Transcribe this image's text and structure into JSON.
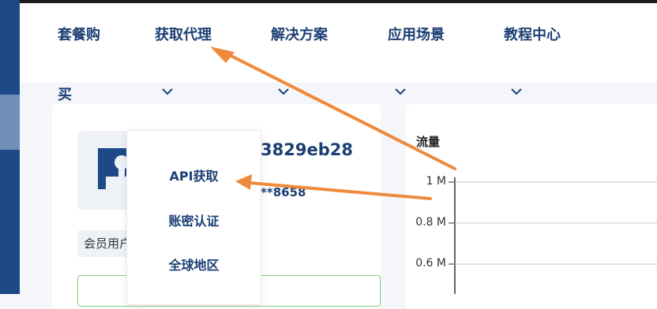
{
  "nav": {
    "items": [
      {
        "label_line1": "套餐购",
        "label_line2": "买"
      },
      {
        "label_line1": "获取代理",
        "label_line2": ""
      },
      {
        "label_line1": "解决方案",
        "label_line2": ""
      },
      {
        "label_line1": "应用场景",
        "label_line2": ""
      },
      {
        "label_line1": "教程中心",
        "label_line2": ""
      }
    ]
  },
  "account": {
    "id_partial": "3829eb28",
    "phone_partial": "**8658",
    "member_label": "会员用户"
  },
  "dropdown": {
    "items": [
      "API获取",
      "账密认证",
      "全球地区"
    ]
  },
  "chart": {
    "title": "流量",
    "ticks": [
      "1 M",
      "0.8 M",
      "0.6 M"
    ]
  },
  "colors": {
    "nav_text": "#1c3f73",
    "sidebar": "#1d4a86",
    "arrow": "#ef8a3c"
  }
}
